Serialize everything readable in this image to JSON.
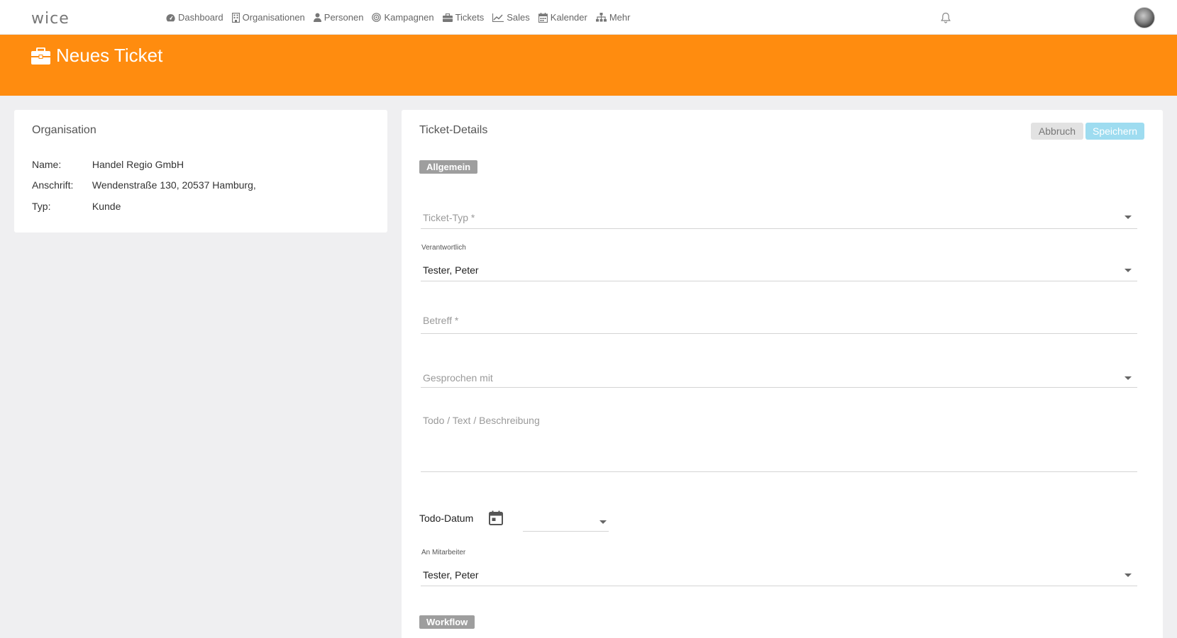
{
  "app": {
    "logo": "wice",
    "nav": [
      {
        "label": "Dashboard",
        "icon": "dashboard-icon"
      },
      {
        "label": "Organisationen",
        "icon": "building-icon"
      },
      {
        "label": "Personen",
        "icon": "person-icon"
      },
      {
        "label": "Kampagnen",
        "icon": "target-icon"
      },
      {
        "label": "Tickets",
        "icon": "briefcase-icon"
      },
      {
        "label": "Sales",
        "icon": "line-chart-icon"
      },
      {
        "label": "Kalender",
        "icon": "calendar-icon"
      },
      {
        "label": "Mehr",
        "icon": "sitemap-icon"
      }
    ]
  },
  "banner": {
    "title": "Neues Ticket",
    "icon": "briefcase-icon",
    "color": "#ff8c0f"
  },
  "organisation": {
    "title": "Organisation",
    "rows": [
      {
        "label": "Name:",
        "value": "Handel Regio GmbH"
      },
      {
        "label": "Anschrift:",
        "value": "Wendenstraße 130, 20537 Hamburg,"
      },
      {
        "label": "Typ:",
        "value": "Kunde"
      }
    ]
  },
  "details": {
    "title": "Ticket-Details",
    "cancel_label": "Abbruch",
    "save_label": "Speichern",
    "section_general": "Allgemein",
    "ticket_type_placeholder": "Ticket-Typ *",
    "responsible_label": "Verantwortlich",
    "responsible_value": "Tester, Peter",
    "subject_placeholder": "Betreff *",
    "spoken_with_placeholder": "Gesprochen mit",
    "description_placeholder": "Todo / Text / Beschreibung",
    "todo_date_label": "Todo-Datum",
    "employee_label": "An Mitarbeiter",
    "employee_value": "Tester, Peter",
    "section_workflow": "Workflow"
  }
}
